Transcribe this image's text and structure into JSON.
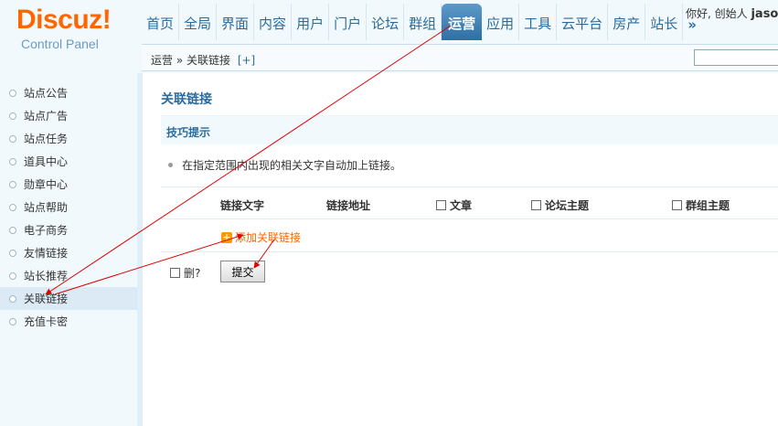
{
  "logo": {
    "brand": "Discuz",
    "exclaim": "!",
    "subtitle": "Control Panel"
  },
  "topnav": {
    "items": [
      "首页",
      "全局",
      "界面",
      "内容",
      "用户",
      "门户",
      "论坛",
      "群组",
      "运营",
      "应用",
      "工具",
      "云平台",
      "房产",
      "站长"
    ],
    "active": "运营",
    "more": "»"
  },
  "user": {
    "greeting": "你好, 创始人",
    "name": "jaso"
  },
  "breadcrumb": {
    "text": "运营 » 关联链接",
    "add": "[+]"
  },
  "sidebar": {
    "items": [
      "站点公告",
      "站点广告",
      "站点任务",
      "道具中心",
      "勋章中心",
      "站点帮助",
      "电子商务",
      "友情链接",
      "站长推荐",
      "关联链接",
      "充值卡密"
    ],
    "active_index": 9
  },
  "main": {
    "title": "关联链接",
    "tips_title": "技巧提示",
    "tip": "在指定范围内出现的相关文字自动加上链接。",
    "columns": {
      "text": "链接文字",
      "url": "链接地址",
      "article": "文章",
      "forum_thread": "论坛主题",
      "group_thread": "群组主题"
    },
    "add_link": "添加关联链接",
    "delete_label": "删?",
    "submit_label": "提交"
  },
  "colors": {
    "accent": "#2b6b9c",
    "logo": "#ff6600",
    "annotation": "#dd0000"
  }
}
